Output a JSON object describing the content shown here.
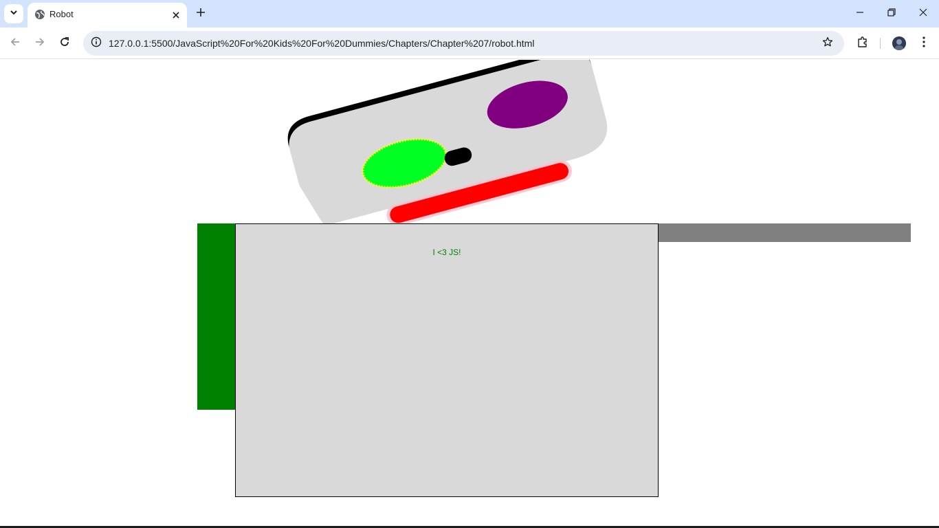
{
  "browser": {
    "tab_title": "Robot",
    "url": "127.0.0.1:5500/JavaScript%20For%20Kids%20For%20Dummies/Chapters/Chapter%207/robot.html",
    "icons": {
      "tab_search": "chevron-down-icon",
      "favicon": "globe-icon",
      "tab_close": "close-icon",
      "new_tab": "plus-icon",
      "minimize": "minimize-icon",
      "restore": "restore-icon",
      "close_window": "close-icon",
      "back": "arrow-left-icon",
      "forward": "arrow-right-icon",
      "reload": "reload-icon",
      "site_info": "info-icon",
      "bookmark": "star-icon",
      "extensions": "puzzle-icon",
      "menu": "kebab-menu-icon"
    }
  },
  "page": {
    "body_text": "I <3 JS!",
    "colors": {
      "head_fill": "#d9d9d9",
      "head_top_border": "#000000",
      "left_eye": "#00ff22",
      "left_eye_outline": "#ffff00",
      "right_eye": "#800080",
      "nose": "#000000",
      "mouth": "#ff0000",
      "mouth_glow": "#ffc0cb",
      "left_arm": "#008000",
      "right_arm": "#808080",
      "body": "#d9d9d9",
      "body_text": "#008000"
    }
  }
}
